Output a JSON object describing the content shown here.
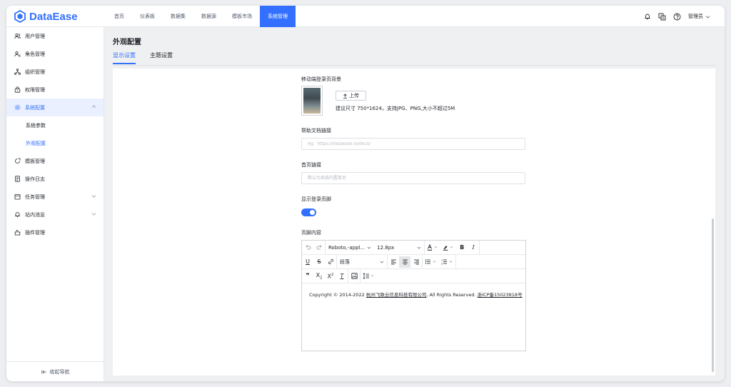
{
  "app": {
    "logo_text": "DataEase"
  },
  "topnav": [
    {
      "label": "首页",
      "active": false
    },
    {
      "label": "仪表板",
      "active": false
    },
    {
      "label": "数据集",
      "active": false
    },
    {
      "label": "数据源",
      "active": false
    },
    {
      "label": "模板市场",
      "active": false
    },
    {
      "label": "系统管理",
      "active": true
    }
  ],
  "topright": {
    "user_label": "管理员"
  },
  "sidebar": {
    "items": [
      {
        "label": "用户管理"
      },
      {
        "label": "角色管理"
      },
      {
        "label": "组织管理"
      },
      {
        "label": "权限管理"
      },
      {
        "label": "系统配置"
      },
      {
        "label": "系统参数"
      },
      {
        "label": "外观配置"
      },
      {
        "label": "模板管理"
      },
      {
        "label": "操作日志"
      },
      {
        "label": "任务管理"
      },
      {
        "label": "站内消息"
      },
      {
        "label": "插件管理"
      }
    ],
    "collapse_label": "收起导航"
  },
  "page": {
    "title": "外观配置",
    "tabs": [
      {
        "label": "显示设置",
        "active": true
      },
      {
        "label": "主题设置",
        "active": false
      }
    ]
  },
  "form": {
    "mobile_bg_label": "移动端登录页背景",
    "upload_label": "上传",
    "upload_hint": "建议尺寸 750*1624，支持JPG、PNG,大小不超过5M",
    "help_link_label": "帮助文档链接",
    "help_link_placeholder": "eg：https://dataease.io/docs/",
    "home_link_label": "首页链接",
    "home_link_placeholder": "默认为系统内置首页",
    "show_footer_label": "显示登录页脚",
    "show_footer": true,
    "footer_content_label": "页脚内容"
  },
  "editor": {
    "font_family": "Roboto,-appl...",
    "font_size": "12.8px",
    "paragraph": "段落",
    "content_prefix": "Copyright © 2014-2022 ",
    "content_company": "杭州飞致云信息科技有限公司",
    "content_middle": ", All Rights Reserved. ",
    "content_icp": "浙ICP备15023818号"
  },
  "colors": {
    "accent": "#3370ff"
  }
}
